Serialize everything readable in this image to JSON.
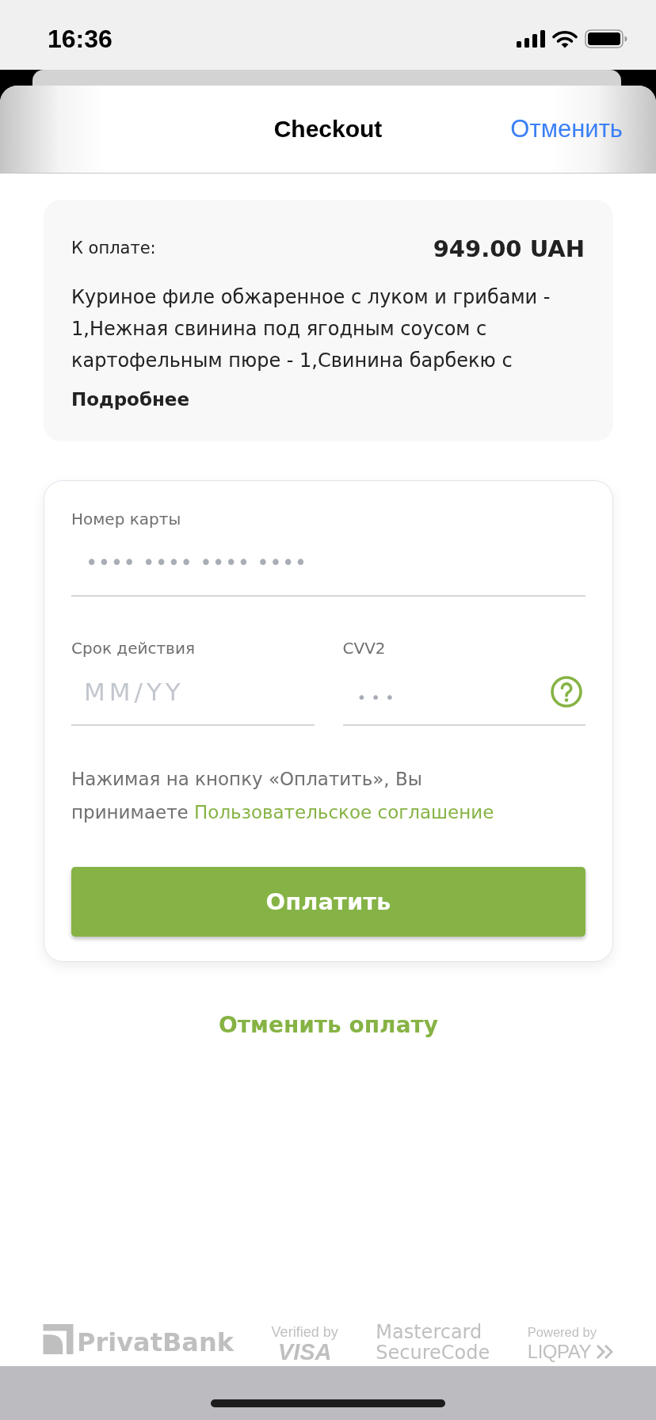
{
  "status_bar": {
    "time": "16:36"
  },
  "header": {
    "title": "Checkout",
    "cancel": "Отменить"
  },
  "order": {
    "amount_label": "К оплате:",
    "amount": "949.00 UAH",
    "description": "Куриное филе обжаренное с луком и грибами - 1,Нежная свинина под ягодным соусом с картофельным пюре - 1,Свинина барбекю с",
    "more_link": "Подробнее"
  },
  "card_form": {
    "fields": [
      {
        "kind": "card_number",
        "label": "Номер карты",
        "placeholder": "•••• •••• •••• ••••"
      },
      {
        "kind": "expiry",
        "label": "Срок действия",
        "placeholder": "MM/YY"
      },
      {
        "kind": "cvv",
        "label": "CVV2",
        "placeholder": "•••"
      }
    ],
    "terms": {
      "text": "Нажимая на кнопку «Оплатить», Вы принимаете",
      "link": "Пользовательское соглашение"
    },
    "pay_button": "Оплатить"
  },
  "cancel_payment": "Отменить оплату",
  "footer_logos": [
    {
      "kind": "privatbank",
      "lines": [
        "PrivatBank"
      ]
    },
    {
      "kind": "visa",
      "lines": [
        "Verified by",
        "VISA"
      ]
    },
    {
      "kind": "mastercard",
      "lines": [
        "Mastercard",
        "SecureCode"
      ]
    },
    {
      "kind": "liqpay",
      "lines": [
        "Powered by",
        "LIQPAY"
      ]
    }
  ]
}
